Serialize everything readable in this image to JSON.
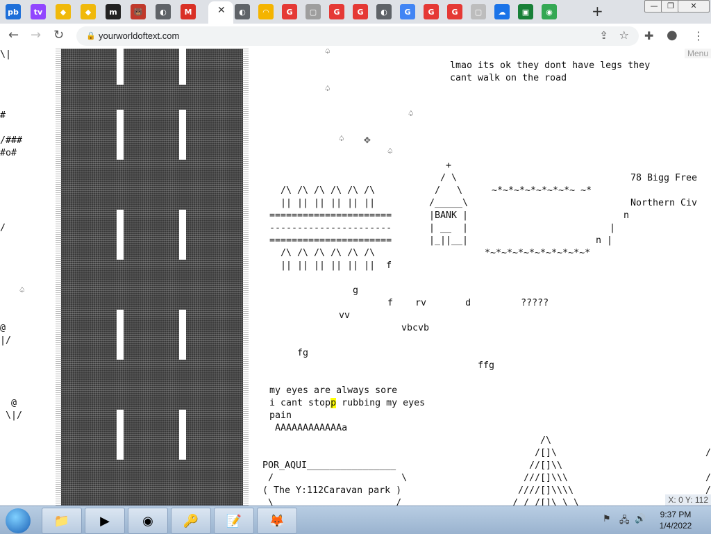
{
  "browser": {
    "active_tab_close": "✕",
    "new_tab": "+",
    "url": "yourworldoftext.com",
    "tabs": [
      {
        "label": "pb",
        "color": "#1e6fd9"
      },
      {
        "label": "tv",
        "color": "#9146ff"
      },
      {
        "label": "◆",
        "color": "#f0b90b"
      },
      {
        "label": "◆",
        "color": "#f0b90b"
      },
      {
        "label": "m",
        "color": "#222222"
      },
      {
        "label": "🐻",
        "color": "#c0392b"
      },
      {
        "label": "◐",
        "color": "#5f6368"
      },
      {
        "label": "M",
        "color": "#d93025"
      },
      {
        "label": "◐",
        "color": "#5f6368"
      },
      {
        "label": "◠",
        "color": "#f4b400"
      },
      {
        "label": "G",
        "color": "#e53935"
      },
      {
        "label": "▢",
        "color": "#9e9e9e"
      },
      {
        "label": "G",
        "color": "#e53935"
      },
      {
        "label": "G",
        "color": "#e53935"
      },
      {
        "label": "◐",
        "color": "#5f6368"
      },
      {
        "label": "G",
        "color": "#4285f4"
      },
      {
        "label": "G",
        "color": "#e53935"
      },
      {
        "label": "G",
        "color": "#e53935"
      },
      {
        "label": "▢",
        "color": "#bdbdbd"
      },
      {
        "label": "☁",
        "color": "#1a73e8"
      },
      {
        "label": "▣",
        "color": "#188038"
      },
      {
        "label": "◉",
        "color": "#34a853"
      }
    ]
  },
  "page": {
    "menu_label": "Menu",
    "coords": "X: 0 Y: 112",
    "texts": {
      "left_1": "\\|",
      "left_2": "#",
      "left_3": "/###\n#o#",
      "left_4": "/",
      "left_5": "♤",
      "left_6": "@\n|/",
      "left_7": " @\n\\|/",
      "spade_1": "♤",
      "spade_2": "♤",
      "spade_3": "♤",
      "spade_4": "♤",
      "spade_5": "♤",
      "lmao": "lmao its ok they dont have legs they\ncant walk on the road",
      "church": "   +\n  / \\\n /   \\\n/_____\\\n|BANK |\n| __  |\n|_||__|",
      "rails": "  /\\ /\\ /\\ /\\ /\\ /\\\n  || || || || || ||\n======================\n----------------------\n======================\n  /\\ /\\ /\\ /\\ /\\ /\\\n  || || || || || ||  f",
      "tilde_top": "~*~*~*~*~*~*~*~ ~*",
      "tilde_bottom": "*~*~*~*~*~*~*~*~*~*",
      "bigg": "78 Bigg Free\n\nNorthern Civ",
      "n1": "n",
      "bar1": "|",
      "n2": "n |",
      "g": "g",
      "f_rv": "f    rv       d         ?????",
      "vv": "vv",
      "vbcvb": "vbcvb",
      "fg": "fg",
      "ffg": "ffg",
      "eyes_1": "my eyes are always sore",
      "eyes_2a": "i cant stop",
      "eyes_2b": "p",
      "eyes_2c": " rubbing my eyes",
      "pain": "pain\n AAAAAAAAAAAAa",
      "por_aqui": "POR_AQUI________________\n /                       \\\n( The Y:112Caravan park )\n \\                      /",
      "tent": "     /\\\n    /[]\\\n   //[]\\\\\n  ///[]\\\\\\\n ////[]\\\\\\\\\n/ / /[]\\ \\ \\",
      "right_edge": "/\n\n/\n/"
    }
  },
  "taskbar": {
    "clock_time": "9:37 PM",
    "clock_date": "1/4/2022",
    "items": [
      "📁",
      "▶",
      "◉",
      "🔑",
      "📝",
      "🦊"
    ]
  }
}
